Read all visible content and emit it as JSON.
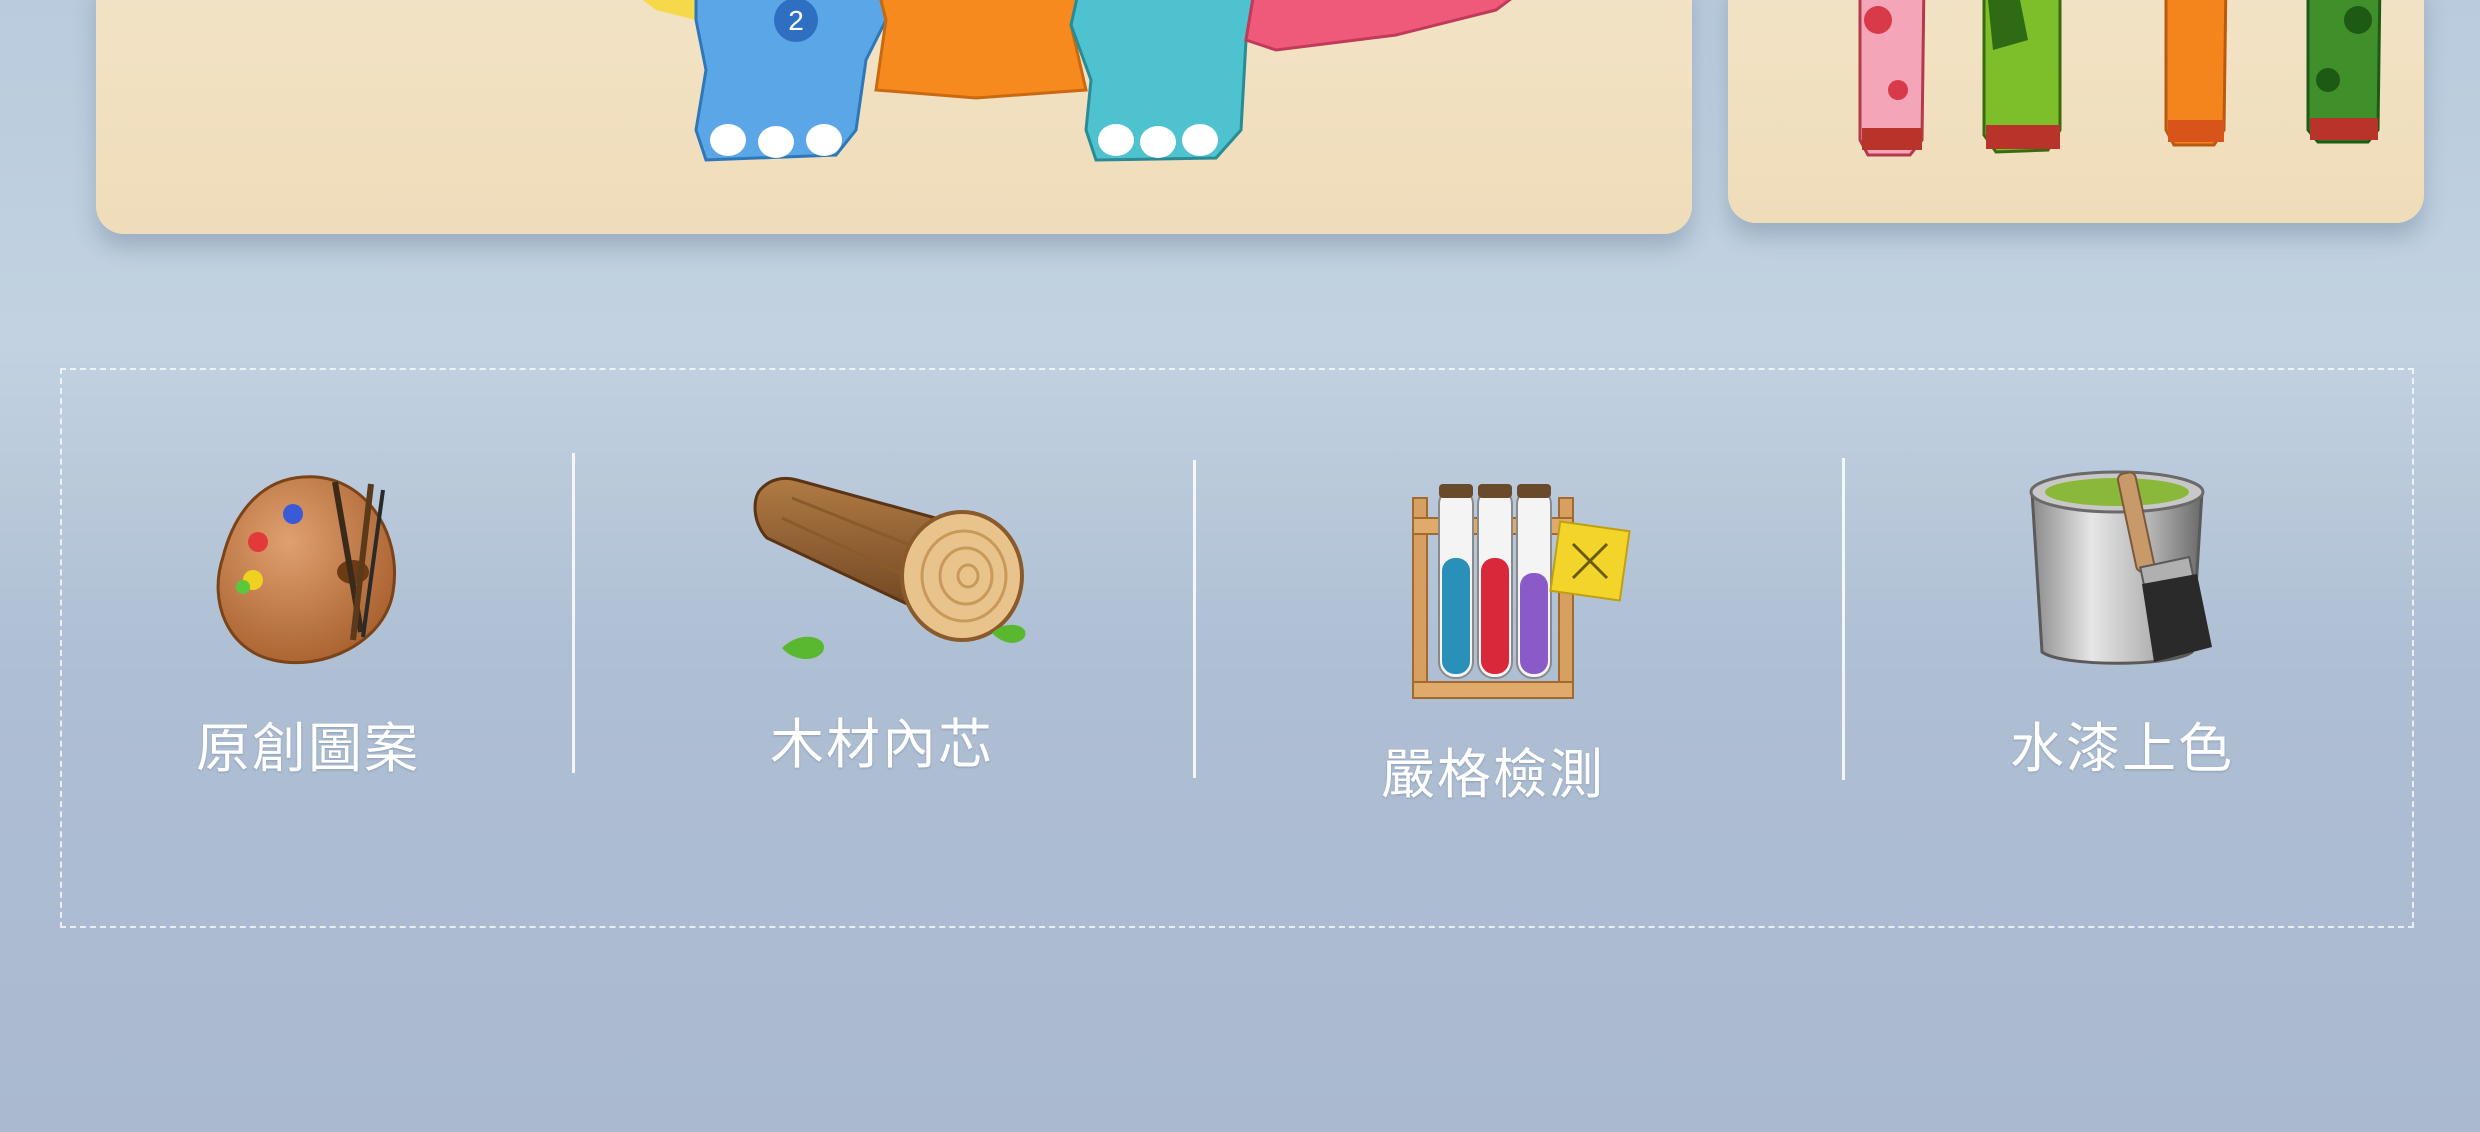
{
  "photo": {
    "puzzle_number": "2"
  },
  "features": [
    {
      "label": "原創圖案",
      "icon": "palette-icon"
    },
    {
      "label": "木材內芯",
      "icon": "wood-log-icon"
    },
    {
      "label": "嚴格檢測",
      "icon": "test-tubes-icon"
    },
    {
      "label": "水漆上色",
      "icon": "paint-bucket-icon"
    }
  ],
  "colors": {
    "background": "#b9cbdd",
    "label": "#ffffff",
    "border": "#ffffff"
  }
}
